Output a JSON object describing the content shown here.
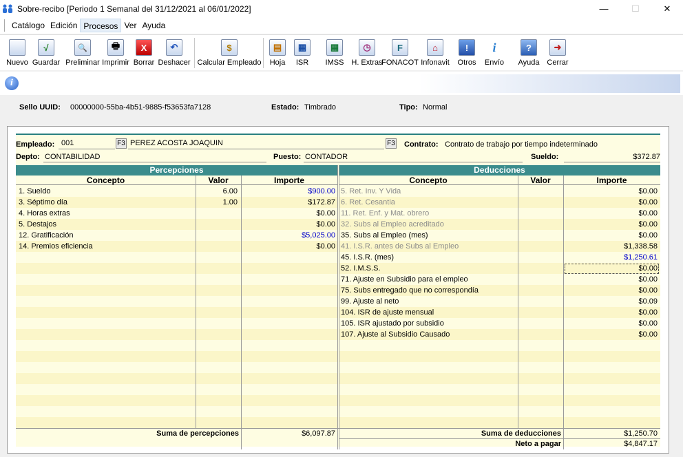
{
  "window": {
    "title": "Sobre-recibo  [Periodo 1 Semanal del 31/12/2021 al 06/01/2022]",
    "minimize": "—",
    "maximize": "☐",
    "close": "✕"
  },
  "menu": [
    "Catálogo",
    "Edición",
    "Procesos",
    "Ver",
    "Ayuda"
  ],
  "toolbar": [
    {
      "label": "Nuevo",
      "icon": "new-document-icon",
      "glyph": ""
    },
    {
      "label": "Guardar",
      "icon": "save-check-icon",
      "glyph": "√"
    },
    {
      "label": "Preliminar",
      "icon": "preview-icon",
      "glyph": "🔍"
    },
    {
      "label": "Imprimir",
      "icon": "print-icon",
      "glyph": "🖶"
    },
    {
      "label": "Borrar",
      "icon": "delete-x-icon",
      "glyph": "X"
    },
    {
      "label": "Deshacer",
      "icon": "undo-icon",
      "glyph": "↶"
    },
    {
      "label": "Calcular Empleado",
      "icon": "calculate-icon",
      "glyph": "$"
    },
    {
      "label": "Hoja",
      "icon": "sheet-icon",
      "glyph": "▤"
    },
    {
      "label": "ISR",
      "icon": "isr-icon",
      "glyph": "▦"
    },
    {
      "label": "IMSS",
      "icon": "imss-icon",
      "glyph": "▦"
    },
    {
      "label": "H. Extras",
      "icon": "overtime-icon",
      "glyph": "◷"
    },
    {
      "label": "FONACOT",
      "icon": "fonacot-icon",
      "glyph": "F"
    },
    {
      "label": "Infonavit",
      "icon": "infonavit-icon",
      "glyph": "⌂"
    },
    {
      "label": "Otros",
      "icon": "others-icon",
      "glyph": "!"
    },
    {
      "label": "Envío",
      "icon": "send-info-icon",
      "glyph": "i"
    },
    {
      "label": "Ayuda",
      "icon": "help-icon",
      "glyph": "?"
    },
    {
      "label": "Cerrar",
      "icon": "exit-icon",
      "glyph": "➜"
    }
  ],
  "seal": {
    "uuid_label": "Sello UUID:",
    "uuid_value": "00000000-55ba-4b51-9885-f53653fa7128",
    "estado_label": "Estado:",
    "estado_value": "Timbrado",
    "tipo_label": "Tipo:",
    "tipo_value": "Normal"
  },
  "employee": {
    "empleado_label": "Empleado:",
    "empleado_id": "001",
    "f3": "F3",
    "empleado_name": "PEREZ ACOSTA  JOAQUIN",
    "contrato_label": "Contrato:",
    "contrato_value": "Contrato de trabajo por tiempo indeterminado",
    "depto_label": "Depto:",
    "depto_value": "CONTABILIDAD",
    "puesto_label": "Puesto:",
    "puesto_value": "CONTADOR",
    "sueldo_label": "Sueldo:",
    "sueldo_value": "$372.87"
  },
  "percepciones": {
    "title": "Percepciones",
    "col_concepto": "Concepto",
    "col_valor": "Valor",
    "col_importe": "Importe",
    "rows": [
      {
        "concepto": "1. Sueldo",
        "valor": "6.00",
        "importe": "$900.00",
        "style": "blue"
      },
      {
        "concepto": "3. Séptimo día",
        "valor": "1.00",
        "importe": "$172.87",
        "style": ""
      },
      {
        "concepto": "4. Horas extras",
        "valor": "",
        "importe": "$0.00",
        "style": ""
      },
      {
        "concepto": "5. Destajos",
        "valor": "",
        "importe": "$0.00",
        "style": ""
      },
      {
        "concepto": "12. Gratificación",
        "valor": "",
        "importe": "$5,025.00",
        "style": "blue"
      },
      {
        "concepto": "14. Premios eficiencia",
        "valor": "",
        "importe": "$0.00",
        "style": ""
      }
    ],
    "total_label": "Suma de percepciones",
    "total_value": "$6,097.87"
  },
  "deducciones": {
    "title": "Deducciones",
    "col_concepto": "Concepto",
    "col_valor": "Valor",
    "col_importe": "Importe",
    "rows": [
      {
        "concepto": "5. Ret. Inv. Y Vida",
        "importe": "$0.00",
        "style": "gray"
      },
      {
        "concepto": "6. Ret. Cesantia",
        "importe": "$0.00",
        "style": "gray"
      },
      {
        "concepto": "11. Ret. Enf. y Mat. obrero",
        "importe": "$0.00",
        "style": "gray"
      },
      {
        "concepto": "32. Subs al Empleo acreditado",
        "importe": "$0.00",
        "style": "gray"
      },
      {
        "concepto": "35. Subs al Empleo (mes)",
        "importe": "$0.00",
        "style": ""
      },
      {
        "concepto": "41. I.S.R. antes de Subs al Empleo",
        "importe": "$1,338.58",
        "style": "gray"
      },
      {
        "concepto": "45. I.S.R. (mes)",
        "importe": "$1,250.61",
        "style": "blue"
      },
      {
        "concepto": "52. I.M.S.S.",
        "importe": "$0.00",
        "style": ""
      },
      {
        "concepto": "71. Ajuste en Subsidio para el empleo",
        "importe": "$0.00",
        "style": ""
      },
      {
        "concepto": "75. Subs entregado que no correspondía",
        "importe": "$0.00",
        "style": ""
      },
      {
        "concepto": "99. Ajuste al neto",
        "importe": "$0.09",
        "style": ""
      },
      {
        "concepto": "104. ISR de ajuste mensual",
        "importe": "$0.00",
        "style": ""
      },
      {
        "concepto": "105. ISR ajustado por subsidio",
        "importe": "$0.00",
        "style": ""
      },
      {
        "concepto": "107. Ajuste al Subsidio Causado",
        "importe": "$0.00",
        "style": ""
      }
    ],
    "total_label": "Suma de deducciones",
    "total_value": "$1,250.70",
    "neto_label": "Neto a pagar",
    "neto_value": "$4,847.17"
  }
}
